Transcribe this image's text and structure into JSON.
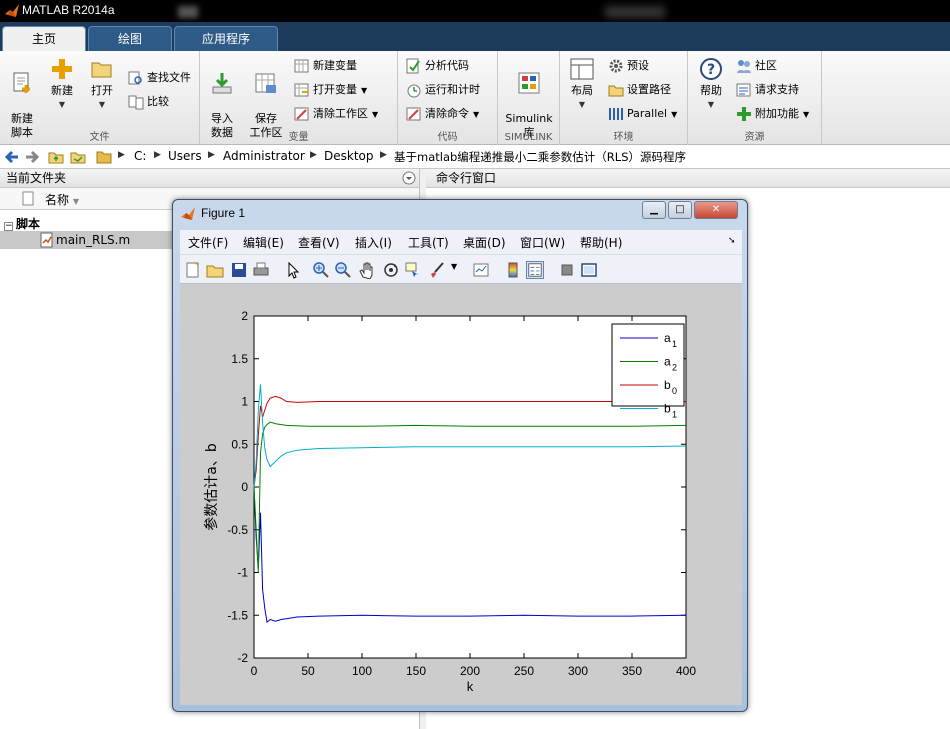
{
  "app": {
    "title": "MATLAB R2014a"
  },
  "tabs": [
    {
      "label": "主页",
      "active": true
    },
    {
      "label": "绘图",
      "active": false
    },
    {
      "label": "应用程序",
      "active": false
    }
  ],
  "ribbon": {
    "file_group": {
      "label": "文件",
      "new_script": "新建\n脚本",
      "new": "新建",
      "open": "打开",
      "find_files": "查找文件",
      "compare": "比较"
    },
    "variable_group": {
      "label": "变量",
      "import_data": "导入\n数据",
      "save_workspace": "保存\n工作区",
      "new_variable": "新建变量",
      "open_variable": "打开变量",
      "clear_workspace": "清除工作区"
    },
    "code_group": {
      "label": "代码",
      "analyze_code": "分析代码",
      "run_and_time": "运行和计时",
      "clear_commands": "清除命令"
    },
    "simulink_group": {
      "label": "SIMULINK",
      "simulink_library": "Simulink\n库"
    },
    "environment_group": {
      "label": "环境",
      "layout": "布局",
      "preferences": "预设",
      "set_path": "设置路径",
      "parallel": "Parallel"
    },
    "resources_group": {
      "label": "资源",
      "help": "帮助",
      "community": "社区",
      "request_support": "请求支持",
      "add_ons": "附加功能"
    }
  },
  "address": {
    "crumbs": [
      "C:",
      "Users",
      "Administrator",
      "Desktop",
      "基于matlab编程递推最小二乘参数估计（RLS）源码程序"
    ]
  },
  "current_folder": {
    "title": "当前文件夹",
    "column_name": "名称",
    "section": "脚本",
    "files": [
      "main_RLS.m"
    ]
  },
  "command_window": {
    "title": "命令行窗口"
  },
  "figure": {
    "title": "Figure 1",
    "menu": [
      "文件(F)",
      "编辑(E)",
      "查看(V)",
      "插入(I)",
      "工具(T)",
      "桌面(D)",
      "窗口(W)",
      "帮助(H)"
    ]
  },
  "chart_data": {
    "type": "line",
    "xlabel": "k",
    "ylabel": "参数估计a、b",
    "xlim": [
      0,
      400
    ],
    "ylim": [
      -2,
      2
    ],
    "xticks": [
      0,
      50,
      100,
      150,
      200,
      250,
      300,
      350,
      400
    ],
    "yticks": [
      -2,
      -1.5,
      -1,
      -0.5,
      0,
      0.5,
      1,
      1.5,
      2
    ],
    "legend_position": "top-right",
    "series": [
      {
        "name": "a",
        "sub": "1",
        "color": "#0000cc",
        "points": [
          [
            0,
            0
          ],
          [
            2,
            -0.6
          ],
          [
            4,
            -0.95
          ],
          [
            6,
            -0.3
          ],
          [
            8,
            -1.2
          ],
          [
            10,
            -1.42
          ],
          [
            12,
            -1.58
          ],
          [
            15,
            -1.55
          ],
          [
            20,
            -1.57
          ],
          [
            25,
            -1.55
          ],
          [
            30,
            -1.54
          ],
          [
            40,
            -1.52
          ],
          [
            60,
            -1.51
          ],
          [
            100,
            -1.5
          ],
          [
            150,
            -1.51
          ],
          [
            200,
            -1.51
          ],
          [
            250,
            -1.5
          ],
          [
            300,
            -1.51
          ],
          [
            350,
            -1.51
          ],
          [
            400,
            -1.5
          ]
        ]
      },
      {
        "name": "a",
        "sub": "2",
        "color": "#008000",
        "points": [
          [
            0,
            0
          ],
          [
            2,
            -0.5
          ],
          [
            4,
            -1.0
          ],
          [
            6,
            0.4
          ],
          [
            8,
            0.62
          ],
          [
            10,
            0.7
          ],
          [
            12,
            0.73
          ],
          [
            15,
            0.76
          ],
          [
            20,
            0.74
          ],
          [
            30,
            0.72
          ],
          [
            50,
            0.71
          ],
          [
            100,
            0.71
          ],
          [
            150,
            0.72
          ],
          [
            200,
            0.71
          ],
          [
            250,
            0.71
          ],
          [
            300,
            0.71
          ],
          [
            350,
            0.71
          ],
          [
            400,
            0.72
          ]
        ]
      },
      {
        "name": "b",
        "sub": "0",
        "color": "#cc0000",
        "points": [
          [
            0,
            0
          ],
          [
            2,
            0.2
          ],
          [
            4,
            0.6
          ],
          [
            6,
            0.95
          ],
          [
            8,
            0.82
          ],
          [
            10,
            0.9
          ],
          [
            12,
            0.98
          ],
          [
            15,
            1.04
          ],
          [
            20,
            1.06
          ],
          [
            25,
            1.04
          ],
          [
            30,
            1.0
          ],
          [
            40,
            0.99
          ],
          [
            60,
            1.0
          ],
          [
            100,
            1.0
          ],
          [
            150,
            1.0
          ],
          [
            200,
            1.0
          ],
          [
            250,
            1.0
          ],
          [
            300,
            1.0
          ],
          [
            350,
            1.0
          ],
          [
            400,
            1.0
          ]
        ]
      },
      {
        "name": "b",
        "sub": "1",
        "color": "#00b0c8",
        "points": [
          [
            0,
            0
          ],
          [
            2,
            0.3
          ],
          [
            4,
            0.9
          ],
          [
            6,
            1.2
          ],
          [
            8,
            0.75
          ],
          [
            10,
            0.45
          ],
          [
            12,
            0.32
          ],
          [
            15,
            0.24
          ],
          [
            20,
            0.3
          ],
          [
            25,
            0.36
          ],
          [
            30,
            0.4
          ],
          [
            40,
            0.43
          ],
          [
            60,
            0.45
          ],
          [
            100,
            0.46
          ],
          [
            150,
            0.47
          ],
          [
            200,
            0.47
          ],
          [
            250,
            0.47
          ],
          [
            300,
            0.47
          ],
          [
            350,
            0.47
          ],
          [
            400,
            0.48
          ]
        ]
      }
    ]
  }
}
